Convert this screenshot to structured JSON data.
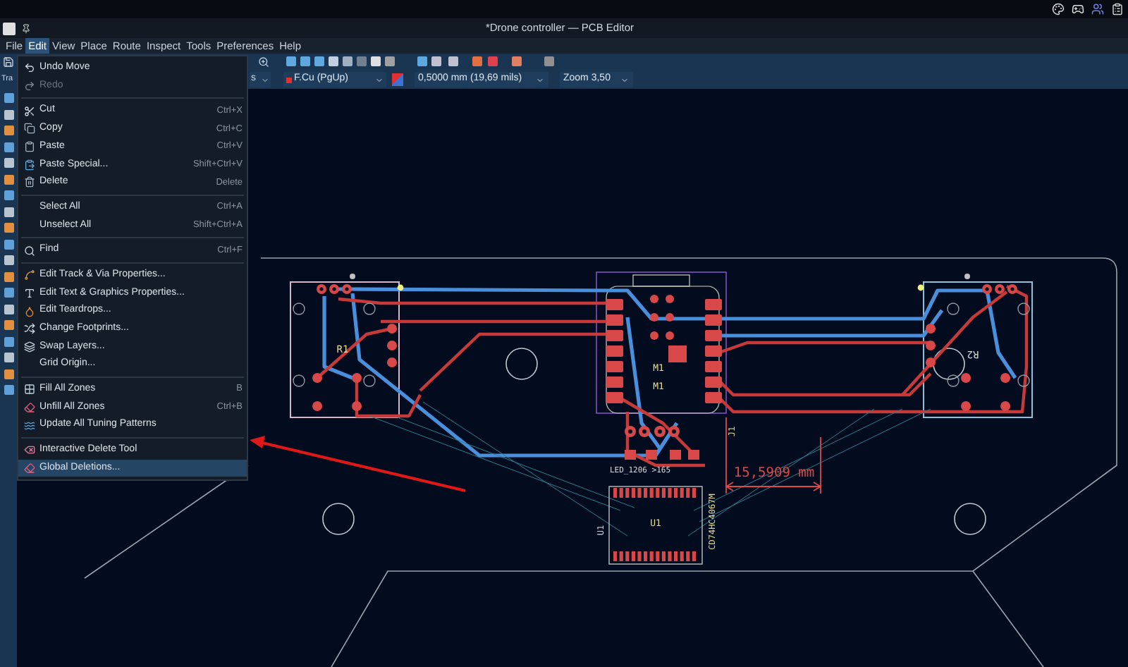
{
  "window": {
    "title": "*Drone controller — PCB Editor"
  },
  "menubar": [
    {
      "label": "File",
      "selected": false
    },
    {
      "label": "Edit",
      "selected": true
    },
    {
      "label": "View",
      "selected": false
    },
    {
      "label": "Place",
      "selected": false
    },
    {
      "label": "Route",
      "selected": false
    },
    {
      "label": "Inspect",
      "selected": false
    },
    {
      "label": "Tools",
      "selected": false
    },
    {
      "label": "Preferences",
      "selected": false
    },
    {
      "label": "Help",
      "selected": false
    }
  ],
  "toolbar": {
    "tool_tab": "Tra",
    "partial_dropdown": "s",
    "layer": "F.Cu (PgUp)",
    "track_width": "0,5000 mm (19,69 mils)",
    "zoom": "Zoom 3,50"
  },
  "edit_menu": [
    {
      "kind": "item",
      "label": "Undo Move",
      "disabled": false,
      "selected": false
    },
    {
      "kind": "item",
      "label": "Redo",
      "disabled": true,
      "selected": false
    },
    {
      "kind": "separator"
    },
    {
      "kind": "item",
      "label": "Cut",
      "shortcut": "Ctrl+X",
      "disabled": false,
      "selected": false
    },
    {
      "kind": "item",
      "label": "Copy",
      "shortcut": "Ctrl+C",
      "disabled": false,
      "selected": false
    },
    {
      "kind": "item",
      "label": "Paste",
      "shortcut": "Ctrl+V",
      "disabled": false,
      "selected": false
    },
    {
      "kind": "item",
      "label": "Paste Special...",
      "shortcut": "Shift+Ctrl+V",
      "disabled": false,
      "selected": false
    },
    {
      "kind": "item",
      "label": "Delete",
      "shortcut": "Delete",
      "disabled": false,
      "selected": false
    },
    {
      "kind": "separator"
    },
    {
      "kind": "item",
      "label": "Select All",
      "shortcut": "Ctrl+A",
      "disabled": false,
      "selected": false
    },
    {
      "kind": "item",
      "label": "Unselect All",
      "shortcut": "Shift+Ctrl+A",
      "disabled": false,
      "selected": false
    },
    {
      "kind": "separator"
    },
    {
      "kind": "item",
      "label": "Find",
      "shortcut": "Ctrl+F",
      "disabled": false,
      "selected": false
    },
    {
      "kind": "separator"
    },
    {
      "kind": "item",
      "label": "Edit Track & Via Properties...",
      "disabled": false,
      "selected": false
    },
    {
      "kind": "item",
      "label": "Edit Text & Graphics Properties...",
      "disabled": false,
      "selected": false
    },
    {
      "kind": "item",
      "label": "Edit Teardrops...",
      "disabled": false,
      "selected": false
    },
    {
      "kind": "item",
      "label": "Change Footprints...",
      "disabled": false,
      "selected": false
    },
    {
      "kind": "item",
      "label": "Swap Layers...",
      "disabled": false,
      "selected": false
    },
    {
      "kind": "item",
      "label": "Grid Origin...",
      "disabled": false,
      "selected": false
    },
    {
      "kind": "separator"
    },
    {
      "kind": "item",
      "label": "Fill All Zones",
      "shortcut": "B",
      "disabled": false,
      "selected": false
    },
    {
      "kind": "item",
      "label": "Unfill All Zones",
      "shortcut": "Ctrl+B",
      "disabled": false,
      "selected": false
    },
    {
      "kind": "item",
      "label": "Update All Tuning Patterns",
      "disabled": false,
      "selected": false
    },
    {
      "kind": "separator"
    },
    {
      "kind": "item",
      "label": "Interactive Delete Tool",
      "disabled": false,
      "selected": false
    },
    {
      "kind": "item",
      "label": "Global Deletions...",
      "disabled": false,
      "selected": true
    }
  ],
  "board_labels": [
    {
      "text": "R1",
      "color": "#e6dc8a"
    },
    {
      "text": "R2",
      "color": "#d8d8d8"
    },
    {
      "text": "M1",
      "color": "#e6dc8a"
    },
    {
      "text": "M1",
      "color": "#e6dc8a"
    },
    {
      "text": "J1",
      "color": "#e6dc8a"
    },
    {
      "text": "LED_1206 >165",
      "color": "#d8d8d8"
    },
    {
      "text": "15,5909 mm",
      "color": "#e04848"
    },
    {
      "text": "U1",
      "color": "#d8d8d8"
    },
    {
      "text": "U1",
      "color": "#e6dc8a"
    },
    {
      "text": "CD74HC4067M",
      "color": "#e6dc8a"
    }
  ]
}
